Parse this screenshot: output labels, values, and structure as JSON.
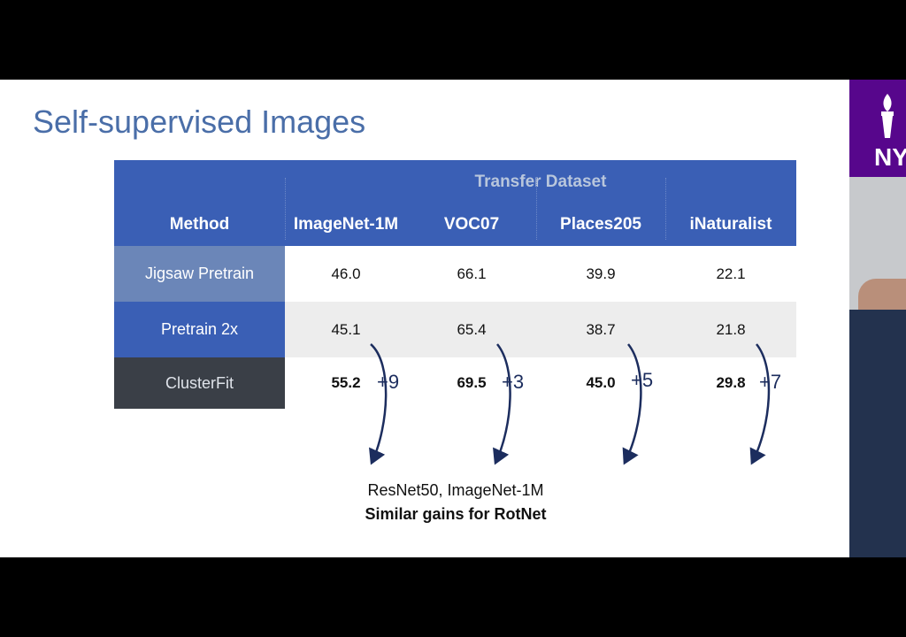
{
  "slide": {
    "title": "Self-supervised Images",
    "caption_line1": "ResNet50, ImageNet-1M",
    "caption_line2": "Similar gains for RotNet"
  },
  "table": {
    "group_header": "Transfer Dataset",
    "method_header": "Method",
    "columns": [
      "ImageNet-1M",
      "VOC07",
      "Places205",
      "iNaturalist"
    ],
    "rows": [
      {
        "method": "Jigsaw Pretrain",
        "values": [
          "46.0",
          "66.1",
          "39.9",
          "22.1"
        ]
      },
      {
        "method": "Pretrain 2x",
        "values": [
          "45.1",
          "65.4",
          "38.7",
          "21.8"
        ]
      },
      {
        "method": "ClusterFit",
        "values": [
          "55.2",
          "69.5",
          "45.0",
          "29.8"
        ]
      }
    ],
    "gains": [
      "+9",
      "+3",
      "+5",
      "+7"
    ]
  },
  "logo": {
    "text": "NY"
  },
  "colors": {
    "header_blue": "#3a5fb5",
    "title_blue": "#4a6ea8",
    "clusterfit_dark": "#3a3f47",
    "arrow_navy": "#1c2d5e",
    "logo_purple": "#57068c"
  }
}
